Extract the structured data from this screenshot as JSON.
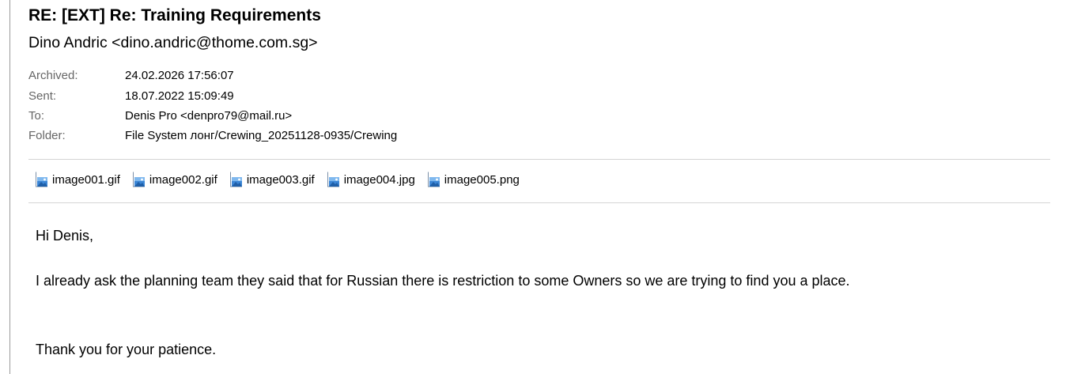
{
  "email": {
    "subject": "RE: [EXT] Re: Training Requirements",
    "sender": "Dino Andric <dino.andric@thome.com.sg>",
    "meta": {
      "archived_label": "Archived:",
      "archived_value": "24.02.2026 17:56:07",
      "sent_label": "Sent:",
      "sent_value": "18.07.2022 15:09:49",
      "to_label": "To:",
      "to_value": "Denis Pro <denpro79@mail.ru>",
      "folder_label": "Folder:",
      "folder_value": "File System лонг/Crewing_20251128-0935/Crewing"
    },
    "attachments": [
      {
        "name": "image001.gif",
        "icon": "image-file-icon"
      },
      {
        "name": "image002.gif",
        "icon": "image-file-icon"
      },
      {
        "name": "image003.gif",
        "icon": "image-file-icon"
      },
      {
        "name": "image004.jpg",
        "icon": "image-file-icon"
      },
      {
        "name": "image005.png",
        "icon": "image-file-icon"
      }
    ],
    "body": {
      "greeting": "Hi Denis,",
      "paragraph": "I already ask the planning team they said that for Russian there is restriction to some Owners so we are trying to find you a place.",
      "closing": "Thank you for your patience."
    }
  }
}
